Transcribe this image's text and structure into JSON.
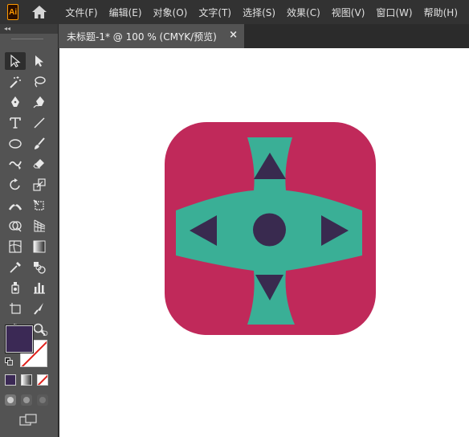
{
  "app": {
    "logo_text": "Ai",
    "logo_color": "#ff9a00"
  },
  "menu": {
    "items": [
      "文件(F)",
      "编辑(E)",
      "对象(O)",
      "文字(T)",
      "选择(S)",
      "效果(C)",
      "视图(V)",
      "窗口(W)",
      "帮助(H)"
    ]
  },
  "toolbar": {
    "collapse_label": "◂◂",
    "tools": [
      [
        "selection-tool",
        "direct-selection-tool"
      ],
      [
        "magic-wand-tool",
        "lasso-tool"
      ],
      [
        "pen-tool",
        "curvature-tool"
      ],
      [
        "type-tool",
        "line-segment-tool"
      ],
      [
        "ellipse-tool",
        "paintbrush-tool"
      ],
      [
        "shaper-tool",
        "eraser-tool"
      ],
      [
        "rotate-tool",
        "scale-tool"
      ],
      [
        "width-tool",
        "free-transform-tool"
      ],
      [
        "shape-builder-tool",
        "perspective-grid-tool"
      ],
      [
        "mesh-tool",
        "gradient-tool"
      ],
      [
        "eyedropper-tool",
        "blend-tool"
      ],
      [
        "symbol-sprayer-tool",
        "column-graph-tool"
      ],
      [
        "artboard-tool",
        "slice-tool"
      ],
      [
        "hand-tool",
        "zoom-tool"
      ]
    ],
    "fill_color": "#3b2955",
    "stroke_color": "none"
  },
  "document": {
    "tab_title": "未标题-1* @ 100 % (CMYK/预览)",
    "close_label": "×"
  },
  "artwork": {
    "background_color": "#c0295a",
    "cross_color": "#3aaf96",
    "symbol_color": "#392a4f"
  }
}
